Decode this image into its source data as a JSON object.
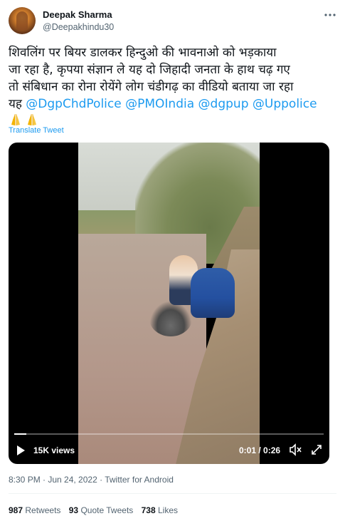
{
  "user": {
    "name": "Deepak Sharma",
    "handle": "@Deepakhindu30"
  },
  "tweet": {
    "text_line1": "शिवलिंग पर बियर डालकर हिन्दुओ की भावनाओ को भड़काया",
    "text_line2": "जा रहा है, कृपया संज्ञान ले यह दो जिहादी जनता के हाथ चढ़ गए",
    "text_line3": "तो संबिधान का रोना रोयेंगे लोग चंडीगढ़ का वीडियो बताया जा रहा",
    "text_prefix4": "यह ",
    "mentions": [
      "@DgpChdPolice",
      "@PMOIndia",
      "@dgpup",
      "@Uppolice"
    ],
    "emojis": [
      "folded-hands-icon",
      "folded-hands-icon"
    ],
    "translate_label": "Translate Tweet"
  },
  "video": {
    "views": "15K views",
    "time": "0:01 / 0:26",
    "progress_fraction": 0.04
  },
  "meta": {
    "timestamp": "8:30 PM · Jun 24, 2022 · Twitter for Android"
  },
  "stats": {
    "retweets_count": "987",
    "retweets_label": "Retweets",
    "quotes_count": "93",
    "quotes_label": "Quote Tweets",
    "likes_count": "738",
    "likes_label": "Likes"
  },
  "colors": {
    "link": "#1d9bf0",
    "muted": "#536471",
    "text": "#0f1419"
  }
}
